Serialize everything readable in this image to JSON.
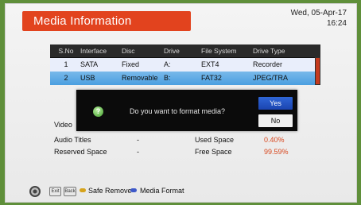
{
  "header": {
    "title": "Media Information",
    "date": "Wed, 05-Apr-17",
    "time": "16:24"
  },
  "table": {
    "columns": [
      "S.No",
      "Interface",
      "Disc",
      "Drive",
      "File System",
      "Drive Type"
    ],
    "rows": [
      {
        "sno": "1",
        "interface": "SATA",
        "disc": "Fixed",
        "drive": "A:",
        "fs": "EXT4",
        "type": "Recorder",
        "selected": false
      },
      {
        "sno": "2",
        "interface": "USB",
        "disc": "Removable",
        "drive": "B:",
        "fs": "FAT32",
        "type": "JPEG/TRA",
        "selected": true
      }
    ]
  },
  "details": {
    "video_label": "Video",
    "audio_titles_label": "Audio Titles",
    "audio_titles_value": "-",
    "reserved_space_label": "Reserved Space",
    "reserved_space_value": "-",
    "used_space_label": "Used Space",
    "used_space_value": "0.40%",
    "free_space_label": "Free Space",
    "free_space_value": "99.59%"
  },
  "dialog": {
    "message": "Do you want to format media?",
    "yes_label": "Yes",
    "no_label": "No",
    "icon": "question-icon"
  },
  "footer": {
    "exit_key": "Exit",
    "back_key": "Back",
    "safe_remove_label": "Safe Remove",
    "media_format_label": "Media Format"
  },
  "colors": {
    "accent": "#e2431e",
    "selected_row": "#4b9fe0",
    "yes_button": "#2f66d6",
    "value_red": "#d8481f",
    "yellow_key": "#d6a31c",
    "blue_key": "#3e59c9"
  }
}
